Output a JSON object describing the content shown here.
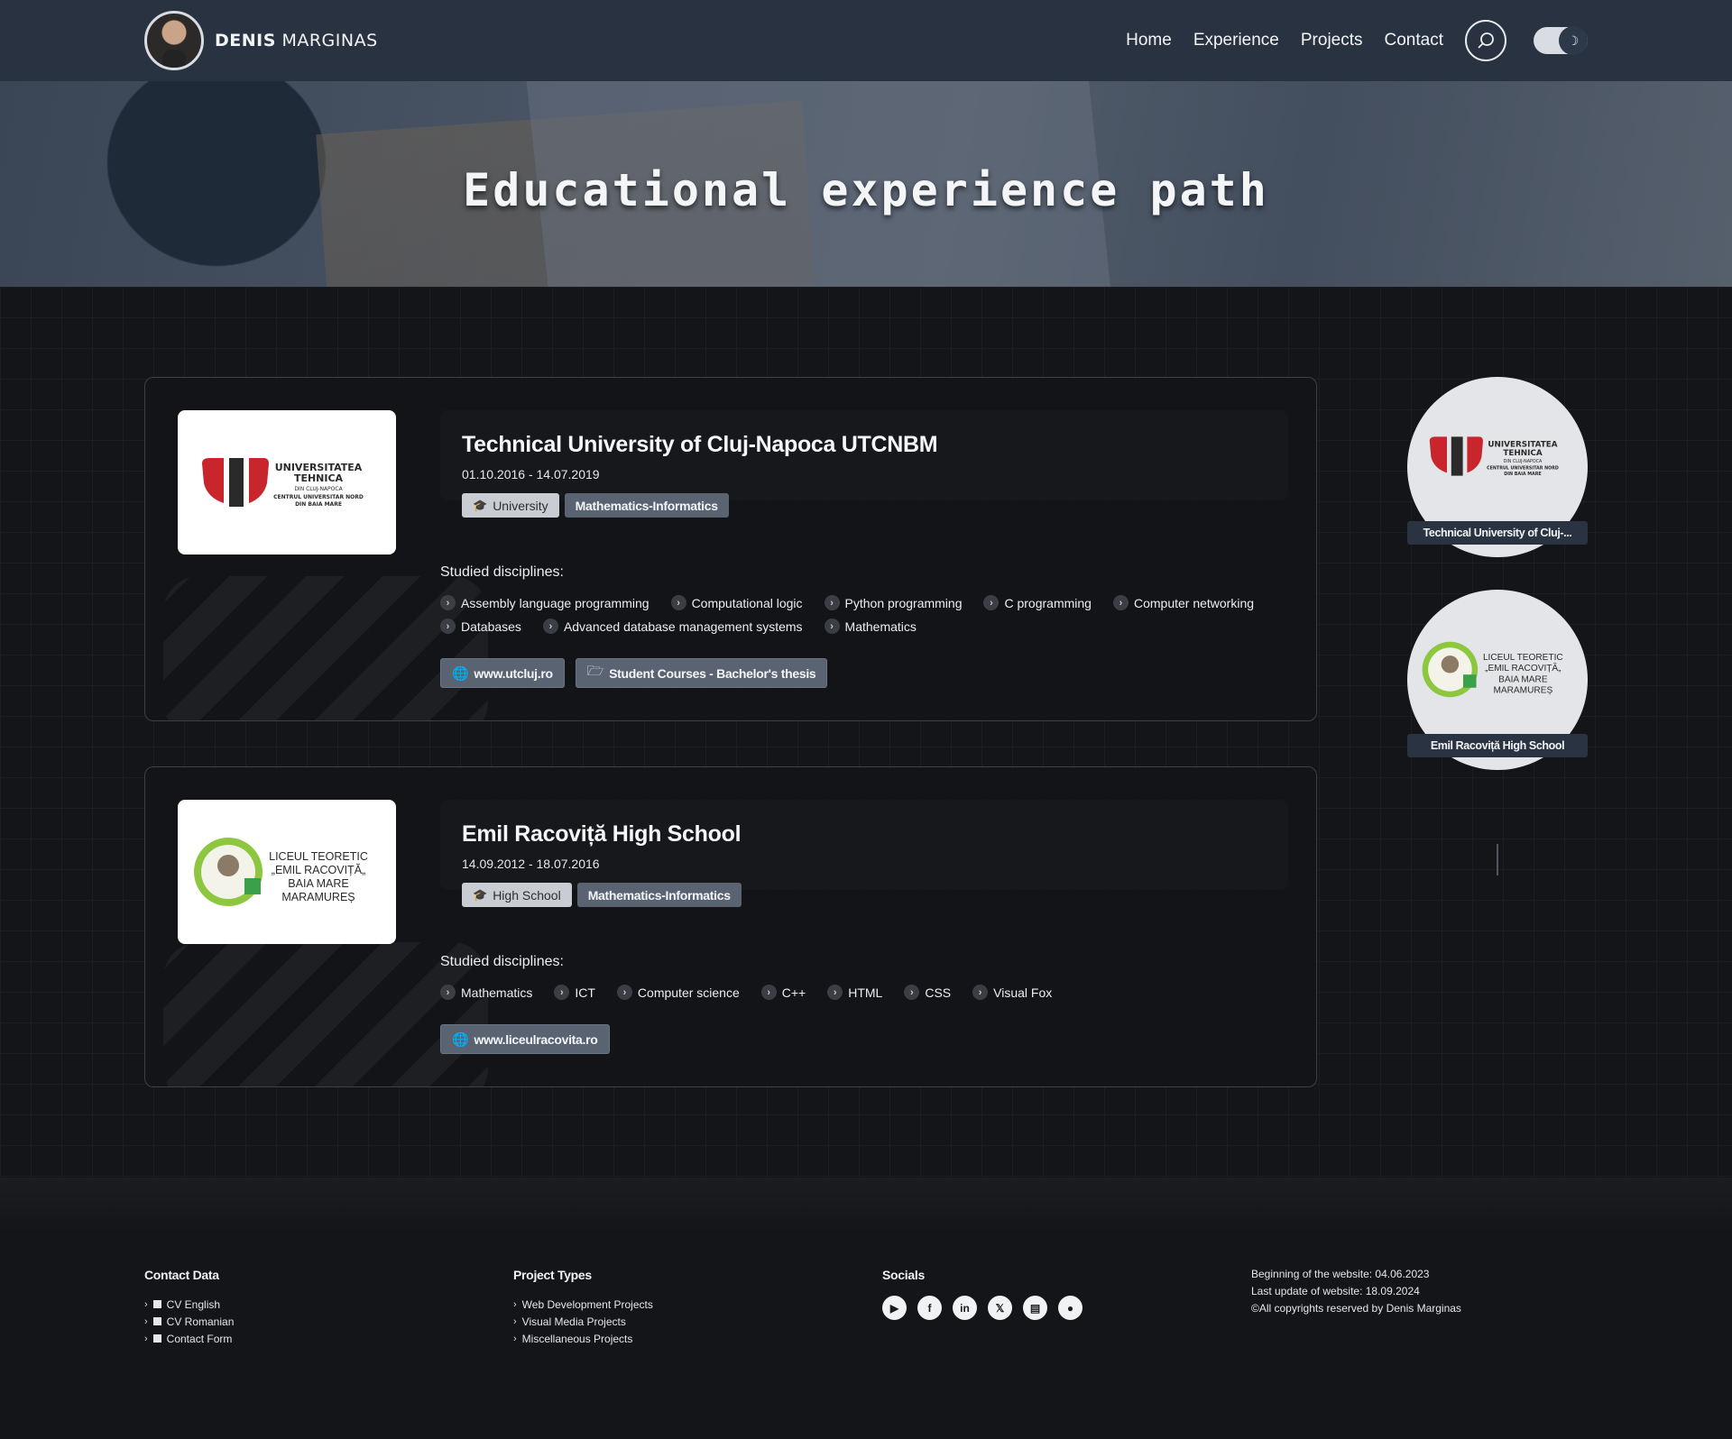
{
  "header": {
    "brand_bold": "DENIS",
    "brand_rest": " MARGINAS",
    "nav": [
      "Home",
      "Experience",
      "Projects",
      "Contact"
    ]
  },
  "hero": {
    "title": "Educational experience path"
  },
  "education": [
    {
      "logo_lines": [
        "UNIVERSITATEA",
        "TEHNICA",
        "DIN CLUJ-NAPOCA",
        "CENTRUL UNIVERSITAR NORD",
        "DIN BAIA MARE"
      ],
      "title": "Technical University of Cluj-Napoca UTCNBM",
      "dates": "01.10.2016  - 14.07.2019",
      "level": "University",
      "specialization": "Mathematics-Informatics",
      "studied_label": "Studied disciplines:",
      "disciplines": [
        "Assembly language programming",
        "Computational logic",
        "Python programming",
        "C programming",
        "Computer networking",
        "Databases",
        "Advanced database management systems",
        "Mathematics"
      ],
      "links": [
        "www.utcluj.ro",
        "Student Courses - Bachelor's thesis"
      ],
      "timeline_label": "Technical University of Cluj-..."
    },
    {
      "logo_lines": [
        "LICEUL TEORETIC",
        "„EMIL RACOVIȚĂ„",
        "BAIA MARE",
        "MARAMUREȘ"
      ],
      "title": "Emil Racoviță High School",
      "dates": "14.09.2012  - 18.07.2016",
      "level": "High School",
      "specialization": "Mathematics-Informatics",
      "studied_label": "Studied disciplines:",
      "disciplines": [
        "Mathematics",
        "ICT",
        "Computer science",
        "C++",
        "HTML",
        "CSS",
        "Visual Fox"
      ],
      "links": [
        "www.liceulracovita.ro"
      ],
      "timeline_label": "Emil Racoviță High School"
    }
  ],
  "footer": {
    "contact_title": "Contact Data",
    "contact_items": [
      "CV English",
      "CV Romanian",
      "Contact Form"
    ],
    "projects_title": "Project Types",
    "projects_items": [
      "Web Development Projects",
      "Visual Media Projects",
      "Miscellaneous Projects"
    ],
    "socials_title": "Socials",
    "socials_icons": [
      "youtube-icon",
      "facebook-icon",
      "linkedin-icon",
      "x-icon",
      "blog-icon",
      "github-icon"
    ],
    "info": [
      "Beginning of the website: 04.06.2023",
      "Last update of website: 18.09.2024",
      "©All copyrights reserved by Denis Marginas"
    ]
  },
  "colors": {
    "header_bg": "#283241",
    "page_bg": "#141518",
    "tag_dark": "#5a6371",
    "tag_light": "#c9ccd2"
  }
}
